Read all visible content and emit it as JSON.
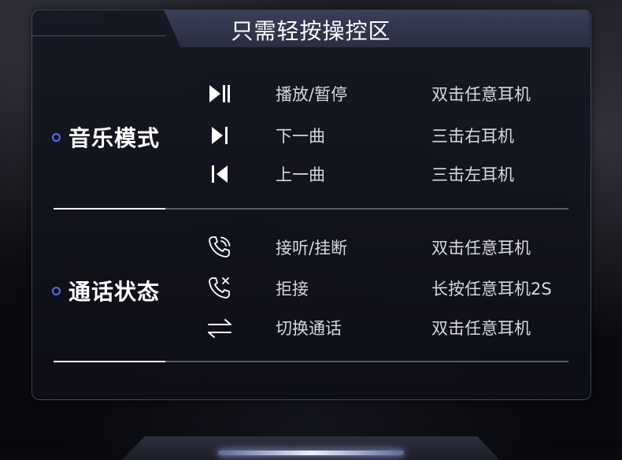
{
  "title": "只需轻按操控区",
  "music": {
    "label": "音乐模式",
    "rows": [
      {
        "icon": "play-pause-icon",
        "action": "播放/暂停",
        "gesture": "双击任意耳机"
      },
      {
        "icon": "next-track-icon",
        "action": "下一曲",
        "gesture": "三击右耳机"
      },
      {
        "icon": "previous-track-icon",
        "action": "上一曲",
        "gesture": "三击左耳机"
      }
    ]
  },
  "call": {
    "label": "通话状态",
    "rows": [
      {
        "icon": "answer-call-icon",
        "action": "接听/挂断",
        "gesture": "双击任意耳机"
      },
      {
        "icon": "reject-call-icon",
        "action": "拒接",
        "gesture": "长按任意耳机2S"
      },
      {
        "icon": "switch-call-icon",
        "action": "切换通话",
        "gesture": "双击任意耳机"
      }
    ]
  },
  "colors": {
    "accent": "#5b6cf0",
    "panel": "#161822",
    "title_tab": "#353950",
    "text": "#d7d8dd"
  }
}
